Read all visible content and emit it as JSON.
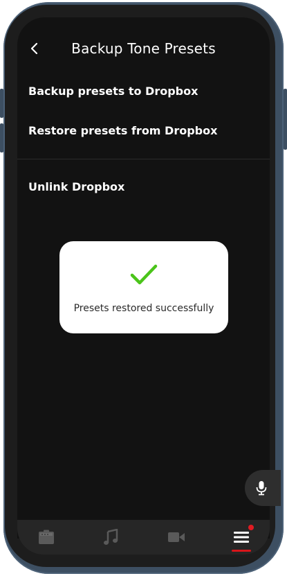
{
  "header": {
    "title": "Backup Tone Presets",
    "back_icon": "chevron-left-icon"
  },
  "menu": {
    "backup_label": "Backup presets to Dropbox",
    "restore_label": "Restore presets from Dropbox",
    "unlink_label": "Unlink Dropbox"
  },
  "toast": {
    "icon": "checkmark-icon",
    "message": "Presets restored successfully",
    "icon_color": "#4bc41a"
  },
  "fab": {
    "icon": "microphone-icon"
  },
  "tabbar": {
    "tabs": [
      {
        "icon": "amplifier-icon",
        "active": false
      },
      {
        "icon": "music-note-icon",
        "active": false
      },
      {
        "icon": "video-camera-icon",
        "active": false
      },
      {
        "icon": "hamburger-menu-icon",
        "active": true
      }
    ],
    "accent": "#d7151a"
  },
  "colors": {
    "background": "#121212",
    "device_frame": "#3d4f62"
  }
}
